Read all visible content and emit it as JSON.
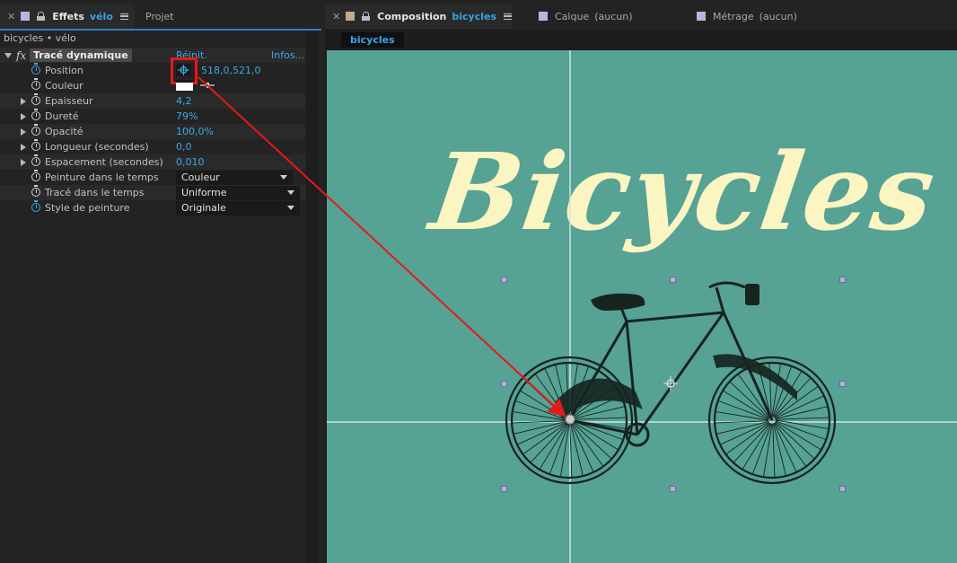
{
  "left_panel": {
    "tab_effects_label": "Effets",
    "tab_effects_layer": "vélo",
    "tab_project_label": "Projet",
    "breadcrumb": "bicycles • vélo",
    "effect": {
      "fx_label": "fx",
      "name": "Tracé dynamique",
      "reset_label": "Réinit.",
      "info_label": "Infos..."
    },
    "properties": [
      {
        "name": "Position",
        "value": "518,0,521,0"
      },
      {
        "name": "Couleur",
        "value": ""
      },
      {
        "name": "Epaisseur",
        "value": "4,2"
      },
      {
        "name": "Dureté",
        "value": "79%"
      },
      {
        "name": "Opacité",
        "value": "100,0%"
      },
      {
        "name": "Longueur (secondes)",
        "value": "0,0"
      },
      {
        "name": "Espacement (secondes)",
        "value": "0,010"
      },
      {
        "name": "Peinture dans le temps",
        "value": "Couleur"
      },
      {
        "name": "Tracé dans le temps",
        "value": "Uniforme"
      },
      {
        "name": "Style de peinture",
        "value": "Originale"
      }
    ]
  },
  "right_panel": {
    "tab_composition_label": "Composition",
    "tab_composition_name": "bicycles",
    "tab_layer_label": "Calque",
    "tab_layer_value": "(aucun)",
    "tab_footage_label": "Métrage",
    "tab_footage_value": "(aucun)",
    "comp_name_tab": "bicycles",
    "canvas_text": "Bicycles"
  },
  "colors": {
    "accent_blue": "#38a3e6",
    "canvas_bg": "#56a294",
    "title_cream": "#fbf5c1",
    "highlight_red": "#e41a1a"
  }
}
